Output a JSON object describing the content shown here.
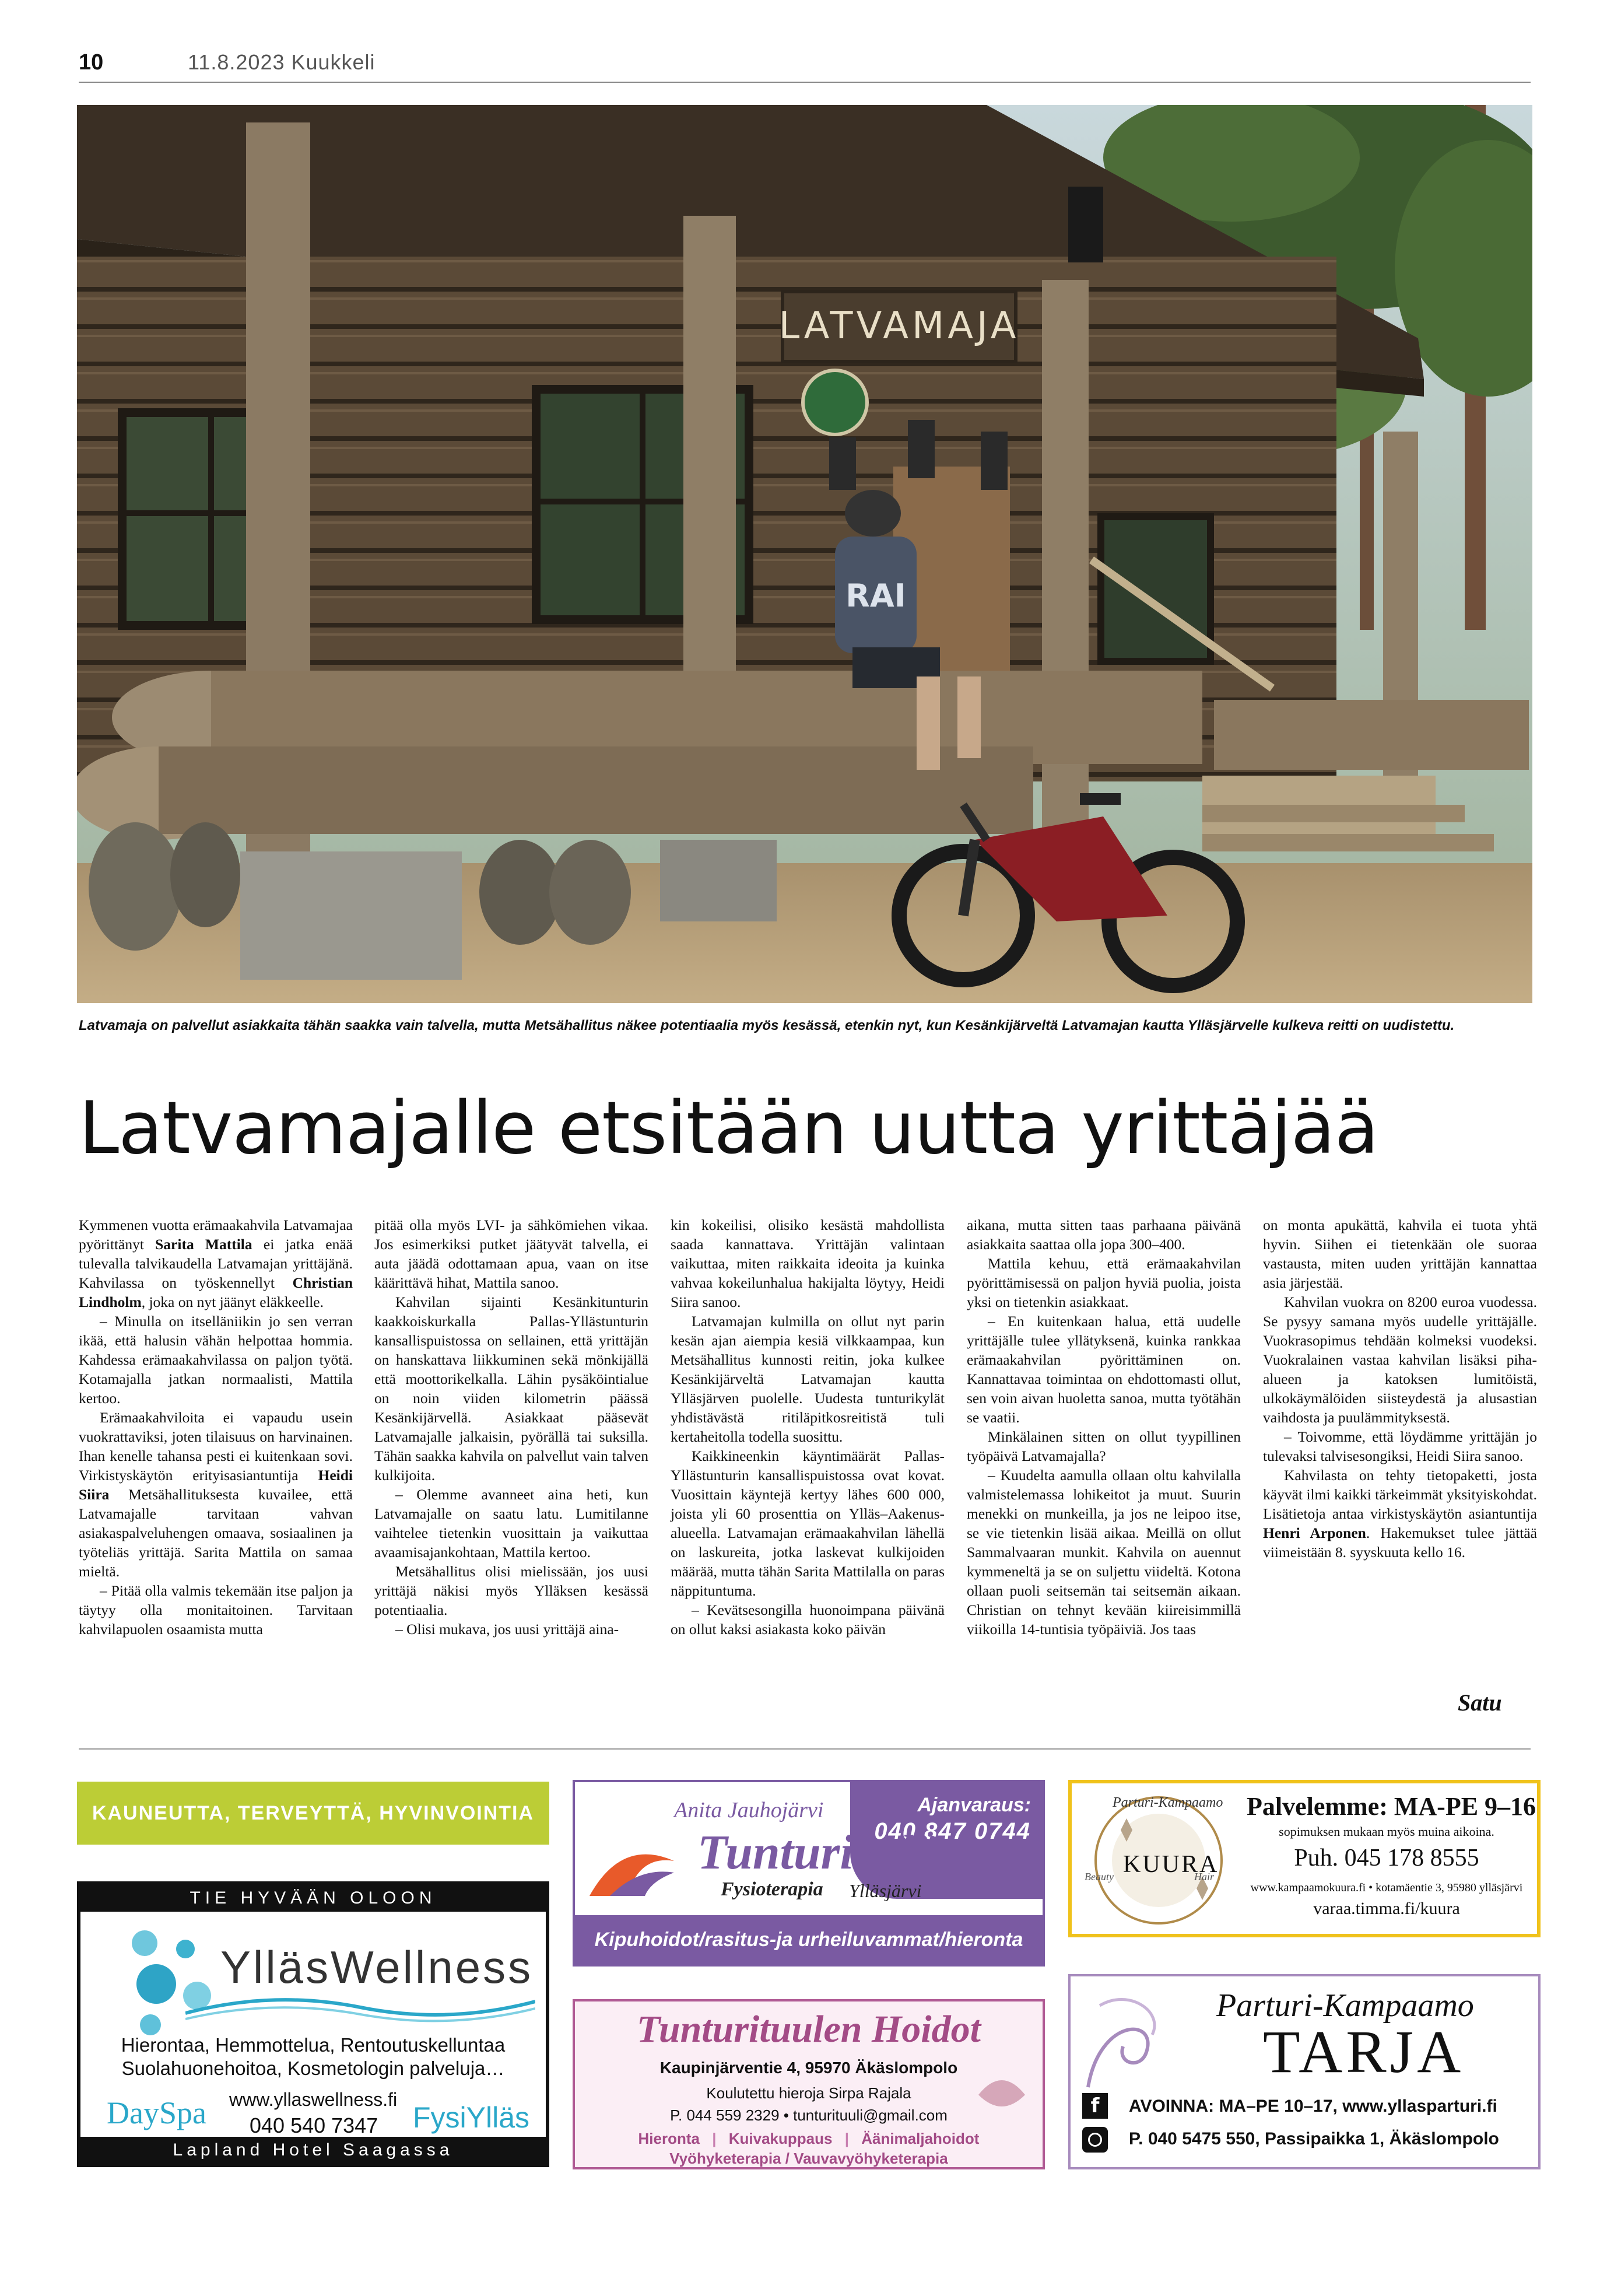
{
  "header": {
    "page_number": "10",
    "date_paper": "11.8.2023 Kuukkeli"
  },
  "photo": {
    "caption": "Latvamaja on palvellut asiakkaita tähän saakka vain talvella, mutta Metsähallitus näkee potentiaalia myös kesässä, etenkin nyt, kun Kesänkijärveltä Latvamajan kautta Ylläsjärvelle kulkeva reitti on uudistettu.",
    "sign_text": "LATVAMAJA",
    "shirt_text": "RAI"
  },
  "article": {
    "headline": "Latvamajalle etsitään uutta yrittäjää",
    "signature": "Satu",
    "columns": [
      [
        {
          "t": "Kymmenen vuotta erämaakahvila Latvamajaa pyörittänyt "
        },
        {
          "b": "Sarita Mattila"
        },
        {
          "t": " ei jatka enää tulevalla talvikaudella Latvamajan yrittäjänä. Kahvilassa on työskennellyt "
        },
        {
          "b": "Christian Lindholm"
        },
        {
          "t": ", joka on nyt jäänyt eläkkeelle."
        },
        {
          "p": "– Minulla on itselläniikin jo sen verran ikää, että halusin vähän helpottaa hommia. Kahdessa erämaakahvilassa on paljon työtä. Kotamajalla jatkan normaalisti, Mattila kertoo."
        },
        {
          "p": "Erämaakahviloita ei vapaudu usein vuokrattaviksi, joten tilaisuus on harvinainen. Ihan kenelle tahansa pesti ei kuitenkaan sovi. Virkistyskäytön erityisasiantuntija "
        },
        {
          "b": "Heidi Siira"
        },
        {
          "t": " Metsähallituksesta kuvailee, että Latvamajalle tarvitaan vahvan asiakaspalveluhengen omaava, sosiaalinen ja työteliäs yrittäjä. Sarita Mattila on samaa mieltä."
        },
        {
          "p": "– Pitää olla valmis tekemään itse paljon ja täytyy olla monitaitoinen. Tarvitaan kahvilapuolen osaamista mutta"
        }
      ],
      [
        {
          "t": "pitää olla myös LVI- ja sähkömiehen vikaa. Jos esimerkiksi putket jäätyvät talvella, ei auta jäädä odottamaan apua, vaan on itse käärittävä hihat, Mattila sanoo."
        },
        {
          "p": "Kahvilan sijainti Kesänkitunturin kaakkoiskurkalla Pallas-Yllästunturin kansallispuistossa on sellainen, että yrittäjän on hanskattava liikkuminen sekä mönkijällä että moottorikelkalla. Lähin pysäköintialue on noin viiden kilometrin päässä Kesänkijärvellä. Asiakkaat pääsevät Latvamajalle jalkaisin, pyörällä tai suksilla. Tähän saakka kahvila on palvellut vain talven kulkijoita."
        },
        {
          "p": "– Olemme avanneet aina heti, kun Latvamajalle on saatu latu. Lumitilanne vaihtelee tietenkin vuosittain ja vaikuttaa avaamisajankohtaan, Mattila kertoo."
        },
        {
          "p": "Metsähallitus olisi mielissään, jos uusi yrittäjä näkisi myös Ylläksen kesässä potentiaalia."
        },
        {
          "p": "– Olisi mukava, jos uusi yrittäjä aina-"
        }
      ],
      [
        {
          "t": "kin kokeilisi, olisiko kesästä mahdollista saada kannattava. Yrittäjän valintaan vaikuttaa, miten raikkaita ideoita ja kuinka vahvaa kokeilunhalua hakijalta löytyy, Heidi Siira sanoo."
        },
        {
          "p": "Latvamajan kulmilla on ollut nyt parin kesän ajan aiempia kesiä vilkkaampaa, kun Metsähallitus kunnosti reitin, joka kulkee Kesänkijärveltä Latvamajan kautta Ylläsjärven puolelle. Uudesta tunturikylät yhdistävästä ritiläpitkosreitistä tuli kertaheitolla todella suosittu."
        },
        {
          "p": "Kaikkineenkin käyntimäärät Pallas-Yllästunturin kansallispuistossa ovat kovat. Vuosittain käyntejä kertyy lähes 600 000, joista yli 60 prosenttia on Ylläs–Aakenus-alueella. Latvamajan erämaakahvilan lähellä on laskureita, jotka laskevat kulkijoiden määrää, mutta tähän Sarita Mattilalla on paras näppituntuma."
        },
        {
          "p": "– Kevätsesongilla huonoimpana päivänä on ollut kaksi asiakasta koko päivän"
        }
      ],
      [
        {
          "t": "aikana, mutta sitten taas parhaana päivänä asiakkaita saattaa olla jopa 300–400."
        },
        {
          "p": "Mattila kehuu, että erämaakahvilan pyörittämisessä on paljon hyviä puolia, joista yksi on tietenkin asiakkaat."
        },
        {
          "p": "– En kuitenkaan halua, että uudelle yrittäjälle tulee yllätyksenä, kuinka rankkaa erämaakahvilan pyörittäminen on. Kannattavaa toimintaa on ehdottomasti ollut, sen voin aivan huoletta sanoa, mutta työtähän se vaatii."
        },
        {
          "p": "Minkälainen sitten on ollut tyypillinen työpäivä Latvamajalla?"
        },
        {
          "p": "– Kuudelta aamulla ollaan oltu kahvilalla valmistelemassa lohikeitot ja muut. Suurin menekki on munkeilla, ja jos ne leipoo itse, se vie tietenkin lisää aikaa. Meillä on ollut Sammalvaaran munkit. Kahvila on auennut kymmeneltä ja se on suljettu viideltä. Kotona ollaan puoli seitsemän tai seitsemän aikaan. Christian on tehnyt kevään kiireisimmillä viikoilla 14-tuntisia työpäiviä. Jos taas"
        }
      ],
      [
        {
          "t": "on monta apukättä, kahvila ei tuota yhtä hyvin. Siihen ei tietenkään ole suoraa vastausta, miten uuden yrittäjän kannattaa asia järjestää."
        },
        {
          "p": "Kahvilan vuokra on 8200 euroa vuodessa. Se pysyy samana myös uudelle yrittäjälle. Vuokrasopimus tehdään kolmeksi vuodeksi. Vuokralainen vastaa kahvilan lisäksi piha-alueen ja katoksen lumitöistä, ulkokäymälöiden siisteydestä ja alusastian vaihdosta ja puulämmityksestä."
        },
        {
          "p": "– Toivomme, että löydämme yrittäjän jo tulevaksi talvisesongiksi, Heidi Siira sanoo."
        },
        {
          "p": "Kahvilasta on tehty tietopaketti, josta käyvät ilmi kaikki tärkeimmät yksityiskohdat. Lisätietoja antaa virkistyskäytön asiantuntija "
        },
        {
          "b": "Henri Arponen"
        },
        {
          "t": ". Hakemukset tulee jättää viimeistään 8. syyskuuta kello 16."
        }
      ]
    ]
  },
  "ads": {
    "section_banner": "KAUNEUTTA, TERVEYTTÄ, HYVINVOINTIA",
    "yllaswellness": {
      "top": "TIE HYVÄÄN OLOON",
      "brand": "YlläsWellness",
      "line1": "Hierontaa, Hemmottelua, Rentoutuskelluntaa",
      "line2": "Suolahuonehoitoa, Kosmetologin palveluja…",
      "web": "www.yllaswellness.fi",
      "phone": "040 540 7347",
      "dayspa": "DaySpa",
      "fysi": "FysiYlläs",
      "bottom": "Lapland Hotel Saagassa"
    },
    "tunturikylan": {
      "name": "Anita Jauhojärvi",
      "booking_label": "Ajanvaraus:",
      "booking_phone": "040 847 0744",
      "brand": "Tunturikylän",
      "sub": "Fysioterapia",
      "place": "Ylläsjärvi",
      "services": "Kipuhoidot/rasitus-ja urheiluvammat/hieronta"
    },
    "kuura": {
      "logo_top": "Parturi-Kampaamo",
      "logo_name": "KUURA",
      "logo_side1": "Beauty",
      "logo_side2": "Hair",
      "title": "Palvelemme: MA-PE  9–16",
      "subtitle": "sopimuksen mukaan myös muina aikoina.",
      "phone": "Puh. 045 178 8555",
      "web": "www.kampaamokuura.fi • kotamäentie 3, 95980 ylläsjärvi",
      "booking": "varaa.timma.fi/kuura"
    },
    "tunturituulen": {
      "brand": "Tunturituulen Hoidot",
      "address": "Kaupinjärventie 4, 95970 Äkäslompolo",
      "person": "Koulutettu hieroja Sirpa Rajala",
      "contact": "P. 044 559 2329 • tunturituuli@gmail.com",
      "services1": [
        "Hieronta",
        "Kuivakuppaus",
        "Äänimaljahoidot"
      ],
      "services2": "Vyöhyketerapia / Vauvavyöhyketerapia"
    },
    "tarja": {
      "top": "Parturi-Kampaamo",
      "brand": "TARJA",
      "hours": "AVOINNA: MA–PE 10–17, www.yllasparturi.fi",
      "contact": "P. 040 5475 550, Passipaikka 1, Äkäslompolo"
    }
  }
}
